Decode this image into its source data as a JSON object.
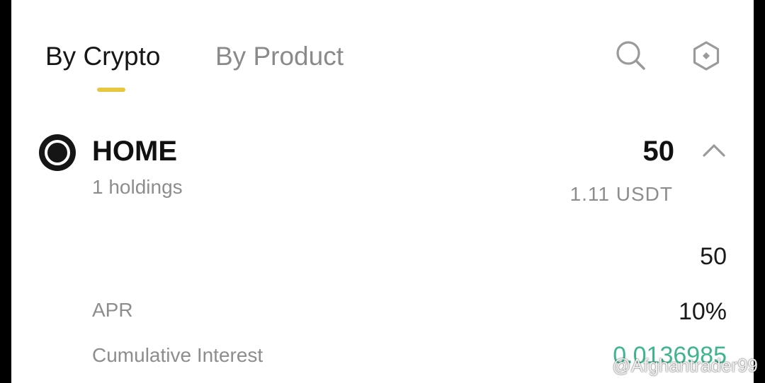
{
  "tabs": {
    "by_crypto": "By Crypto",
    "by_product": "By Product",
    "active": "By Crypto"
  },
  "toolbar": {
    "search_icon": "search-icon",
    "settings_icon": "hexagon-gear-icon"
  },
  "asset": {
    "icon": "coin-ring-icon",
    "symbol": "HOME",
    "holdings": "1 holdings",
    "total_amount": "50",
    "fiat_value": "1.11 USDT",
    "expanded": true
  },
  "detail": {
    "amount": "50",
    "apr_label": "APR",
    "apr_value": "10%",
    "interest_label": "Cumulative Interest",
    "interest_value": "0.0136985"
  },
  "watermark": {
    "text": "@Afghantrader99"
  },
  "colors": {
    "accent_indicator": "#e8c740",
    "interest_green": "#3fb58f",
    "primary_text": "#111111",
    "secondary_text": "#8d8d8d"
  }
}
